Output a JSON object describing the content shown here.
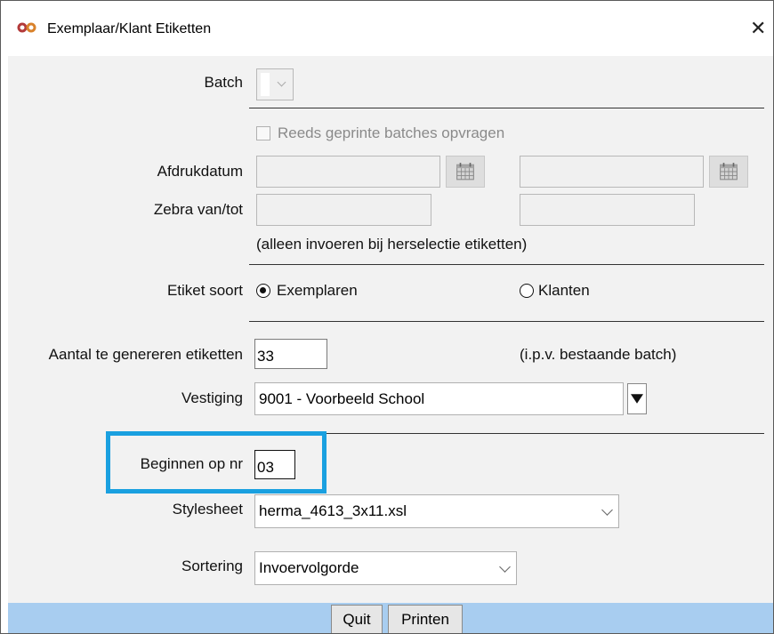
{
  "window": {
    "title": "Exemplaar/Klant Etiketten",
    "close_glyph": "✕",
    "icon": "infinity-logo-icon",
    "accent_color": "#a83232"
  },
  "form": {
    "batch_label": "Batch",
    "reprint_checkbox_label": "Reeds geprinte batches opvragen",
    "reprint_checked": false,
    "print_date_label": "Afdrukdatum",
    "print_date_from": "",
    "print_date_to": "",
    "zebra_label": "Zebra van/tot",
    "zebra_from": "",
    "zebra_to": "",
    "reselect_note": "(alleen invoeren bij herselectie etiketten)",
    "label_type_label": "Etiket soort",
    "label_type_options": [
      "Exemplaren",
      "Klanten"
    ],
    "label_type_selected": "Exemplaren",
    "count_label": "Aantal te genereren etiketten",
    "count_value": "33",
    "count_note": "(i.p.v. bestaande batch)",
    "branch_label": "Vestiging",
    "branch_value": "9001 - Voorbeeld School",
    "start_label": "Beginnen op nr",
    "start_value": "03",
    "stylesheet_label": "Stylesheet",
    "stylesheet_value": "herma_4613_3x11.xsl",
    "sort_label": "Sortering",
    "sort_value": "Invoervolgorde"
  },
  "buttons": {
    "quit": "Quit",
    "print": "Printen"
  },
  "colors": {
    "highlight": "#1aa0e0",
    "footer": "#a8cdf0",
    "background": "#f2f2f2"
  }
}
